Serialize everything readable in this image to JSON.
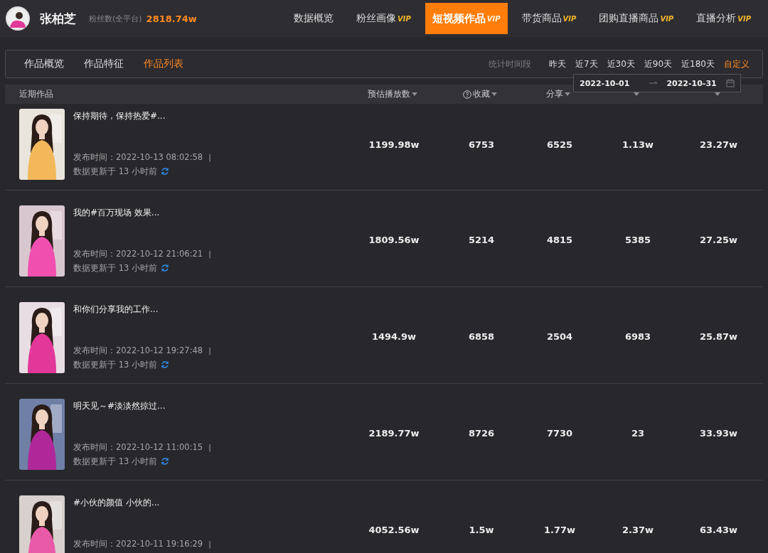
{
  "profile": {
    "name": "张柏芝",
    "fans_label": "粉丝数(全平台)",
    "fans_value": "2818.74w"
  },
  "nav": [
    {
      "label": "数据概览",
      "selected": false
    },
    {
      "label": "粉丝画像",
      "vip_text": "VIP",
      "selected": false
    },
    {
      "label": "短视频作品",
      "vip_text": "VIP",
      "selected": true
    },
    {
      "label": "带货商品",
      "vip_text": "VIP",
      "selected": false
    },
    {
      "label": "团购直播商品",
      "vip_text": "VIP",
      "selected": false
    },
    {
      "label": "直播分析",
      "vip_text": "VIP",
      "selected": false
    }
  ],
  "subtabs": [
    {
      "label": "作品概览",
      "selected": false
    },
    {
      "label": "作品特征",
      "selected": false
    },
    {
      "label": "作品列表",
      "selected": true
    }
  ],
  "period": {
    "label": "统计时间段",
    "options": [
      {
        "label": "昨天",
        "selected": false
      },
      {
        "label": "近7天",
        "selected": false
      },
      {
        "label": "近30天",
        "selected": false
      },
      {
        "label": "近90天",
        "selected": false
      },
      {
        "label": "近180天",
        "selected": false
      },
      {
        "label": "自定义",
        "selected": true
      }
    ]
  },
  "date_range": {
    "start": "2022-10-01",
    "end": "2022-10-31"
  },
  "table": {
    "columns": [
      {
        "label": "近期作品",
        "kind": "plain"
      },
      {
        "label": "预估播放数",
        "kind": "sort"
      },
      {
        "label": "收藏",
        "kind": "help_sort"
      },
      {
        "label": "分享",
        "kind": "sort"
      },
      {
        "kind": "sort"
      },
      {
        "kind": "sort"
      }
    ],
    "rows": [
      {
        "title": "保持期待，保持热爱#...",
        "published": "发布时间：2022-10-13 08:02:58",
        "separator": "|",
        "updated": "数据更新于 13 小时前",
        "values": [
          "1199.98w",
          "6753",
          "6525",
          "1.13w",
          "23.27w"
        ]
      },
      {
        "title": "我的#百万现场 效果...",
        "published": "发布时间：2022-10-12 21:06:21",
        "separator": "|",
        "updated": "数据更新于 13 小时前",
        "values": [
          "1809.56w",
          "5214",
          "4815",
          "5385",
          "27.25w"
        ]
      },
      {
        "title": "和你们分享我的工作...",
        "published": "发布时间：2022-10-12 19:27:48",
        "separator": "|",
        "updated": "数据更新于 13 小时前",
        "values": [
          "1494.9w",
          "6858",
          "2504",
          "6983",
          "25.87w"
        ]
      },
      {
        "title": "明天见～#淡淡然掠过...",
        "published": "发布时间：2022-10-12 11:00:15",
        "separator": "|",
        "updated": "数据更新于 13 小时前",
        "values": [
          "2189.77w",
          "8726",
          "7730",
          "23",
          "33.93w"
        ]
      },
      {
        "title": "#小伙的颜值 小伙的...",
        "published": "发布时间：2022-10-11 19:16:29",
        "separator": "|",
        "values": [
          "4052.56w",
          "1.5w",
          "1.77w",
          "2.37w",
          "63.43w"
        ]
      }
    ]
  }
}
